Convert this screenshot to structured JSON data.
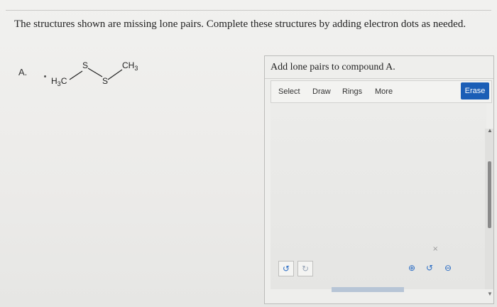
{
  "question": {
    "text": "The structures shown are missing lone pairs. Complete these structures by adding electron dots as needed."
  },
  "part": {
    "label": "A."
  },
  "molecule": {
    "left_group": {
      "text": "H",
      "subscript": "3",
      "suffix": "C"
    },
    "s1": "S",
    "s2": "S",
    "right_group": {
      "prefix": "CH",
      "subscript": "3"
    }
  },
  "panel": {
    "title": "Add lone pairs to compound A.",
    "toolbar": {
      "select": "Select",
      "draw": "Draw",
      "rings": "Rings",
      "more": "More",
      "erase": "Erase"
    }
  },
  "controls": {
    "undo_icon": "↺",
    "redo_icon": "↻",
    "zoom_in_icon": "⊕",
    "zoom_reset_icon": "↺",
    "zoom_out_icon": "⊖"
  }
}
